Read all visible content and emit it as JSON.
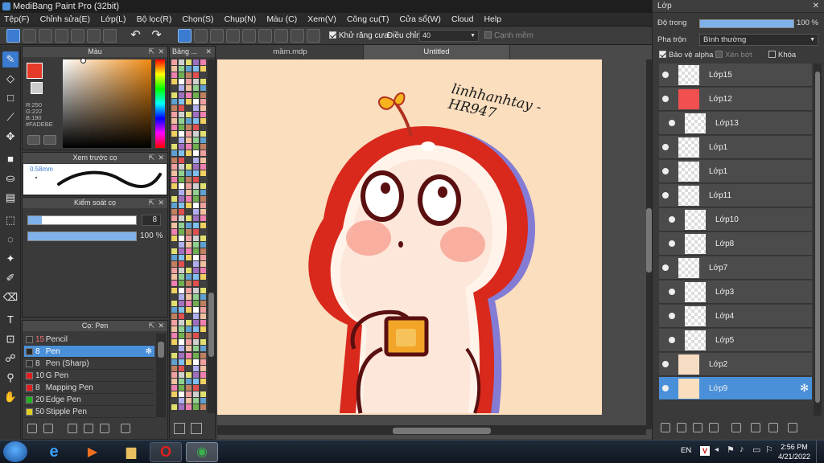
{
  "window": {
    "title": "MediBang Paint Pro (32bit)"
  },
  "menu": [
    "Tệp(F)",
    "Chỉnh sửa(E)",
    "Lớp(L)",
    "Bộ lọc(R)",
    "Chọn(S)",
    "Chụp(N)",
    "Màu (C)",
    "Xem(V)",
    "Công cụ(T)",
    "Cửa sổ(W)",
    "Cloud",
    "Help"
  ],
  "toolbar": {
    "antialias_label": "Khử răng cưa",
    "adjust_label": "Điều chỉnh",
    "adjust_value": "40",
    "snap_label": "Cạnh mềm"
  },
  "color_panel": {
    "title": "Màu",
    "r": "R:250",
    "g": "G:222",
    "b": "B:190",
    "hex": "#FADEBE",
    "color": "#FADEBE"
  },
  "palette_panel": {
    "title": "Bảng ..."
  },
  "preview_panel": {
    "title": "Xem trước cọ",
    "size": "0.58mm"
  },
  "brush_control": {
    "title": "Kiểm soát cọ",
    "size": "8",
    "opacity": "100 %"
  },
  "brush_panel": {
    "title": "Cọ: Pen",
    "items": [
      {
        "size": "15",
        "name": "Pencil",
        "color": "#333333"
      },
      {
        "size": "8",
        "name": "Pen",
        "color": "#2a2a2a"
      },
      {
        "size": "8",
        "name": "Pen (Sharp)",
        "color": "#333333"
      },
      {
        "size": "10",
        "name": "G Pen",
        "color": "#e02020"
      },
      {
        "size": "8",
        "name": "Mapping Pen",
        "color": "#e02020"
      },
      {
        "size": "20",
        "name": "Edge Pen",
        "color": "#20b020"
      },
      {
        "size": "50",
        "name": "Stipple Pen",
        "color": "#e0d020"
      }
    ]
  },
  "tabs": [
    "mầm.mdp",
    "Untitled"
  ],
  "canvas": {
    "signature": "linhhanhtay -HR947",
    "background": "#FADEBE"
  },
  "layer_panel": {
    "title": "Lớp",
    "opacity_label": "Độ trong",
    "opacity_value": "100 %",
    "opacity": 1.0,
    "blend_label": "Pha trộn",
    "blend_value": "Bình thường",
    "protect_alpha": "Bảo vệ alpha",
    "clipping": "Xén bớt",
    "lock": "Khóa",
    "layers": [
      "Lớp15",
      "Lớp12",
      "Lớp13",
      "Lớp1",
      "Lớp1",
      "Lớp11",
      "Lớp10",
      "Lớp8",
      "Lớp7",
      "Lớp3",
      "Lớp4",
      "Lớp5",
      "Lớp2",
      "Lớp9"
    ]
  },
  "taskbar": {
    "lang": "EN",
    "time": "2:56 PM",
    "date": "4/21/2022"
  }
}
